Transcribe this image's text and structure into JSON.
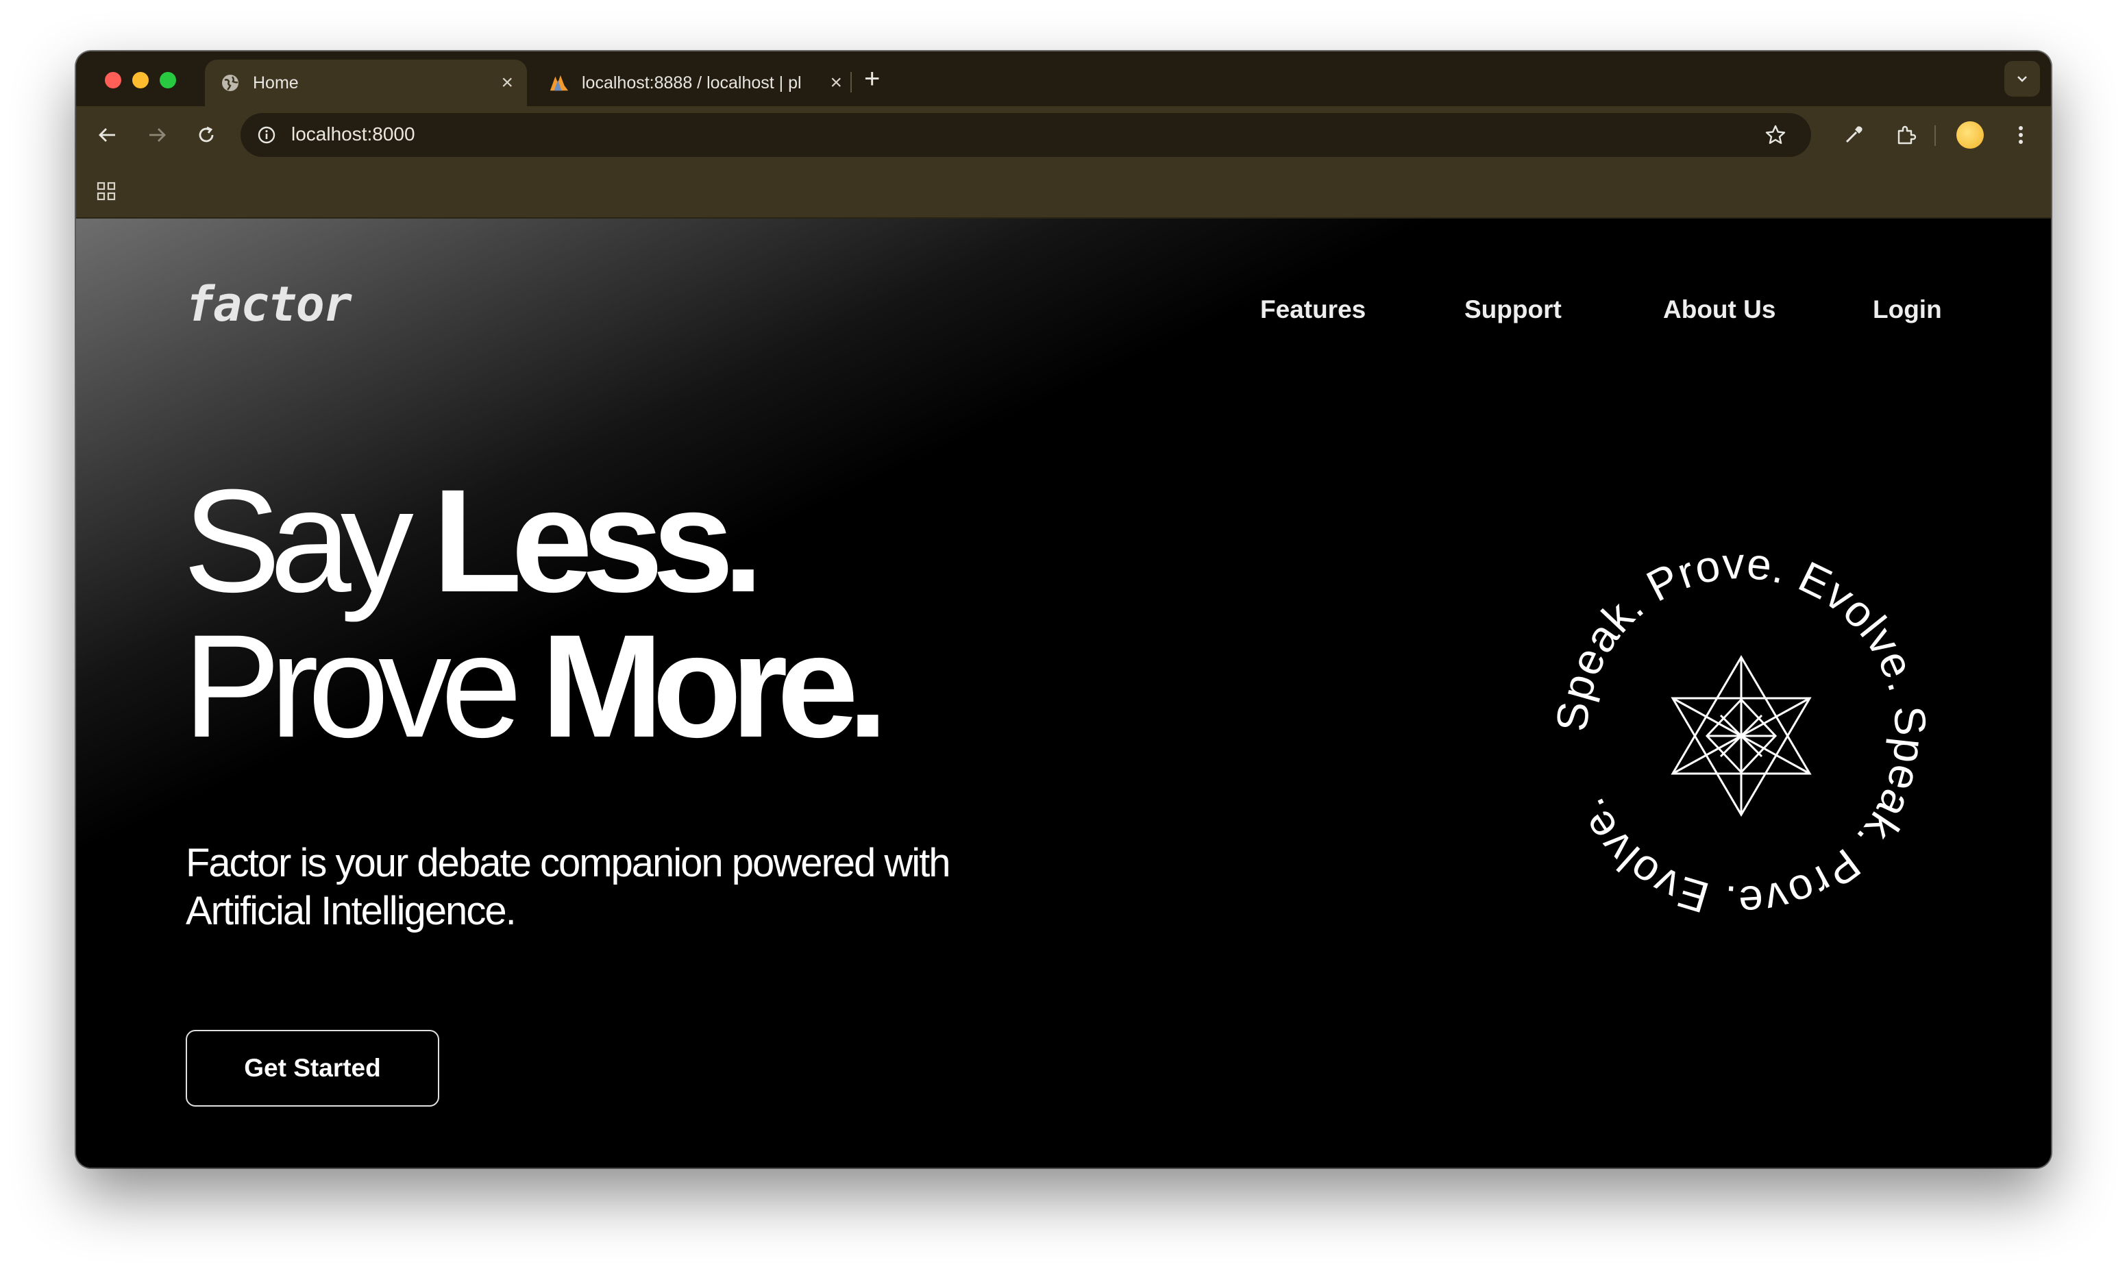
{
  "browser": {
    "tabs": [
      {
        "title": "Home",
        "icon": "globe-icon",
        "active": true
      },
      {
        "title": "localhost:8888 / localhost | pl",
        "icon": "phpmyadmin-icon",
        "active": false
      }
    ],
    "address_bar": {
      "url": "localhost:8000"
    }
  },
  "page": {
    "logo": "factor",
    "nav": [
      "Features",
      "Support",
      "About Us",
      "Login"
    ],
    "hero": {
      "line1_light": "Say",
      "line1_bold": "Less.",
      "line2_light": "Prove",
      "line2_bold": "More."
    },
    "subtitle": "Factor is your debate companion powered with Artificial Intelligence.",
    "cta_label": "Get Started",
    "emblem_text": "Speak. Prove. Evolve. Speak. Prove. Evolve.",
    "colors": {
      "background": "#000000",
      "text": "#ffffff",
      "chrome": "#3d3520"
    }
  }
}
